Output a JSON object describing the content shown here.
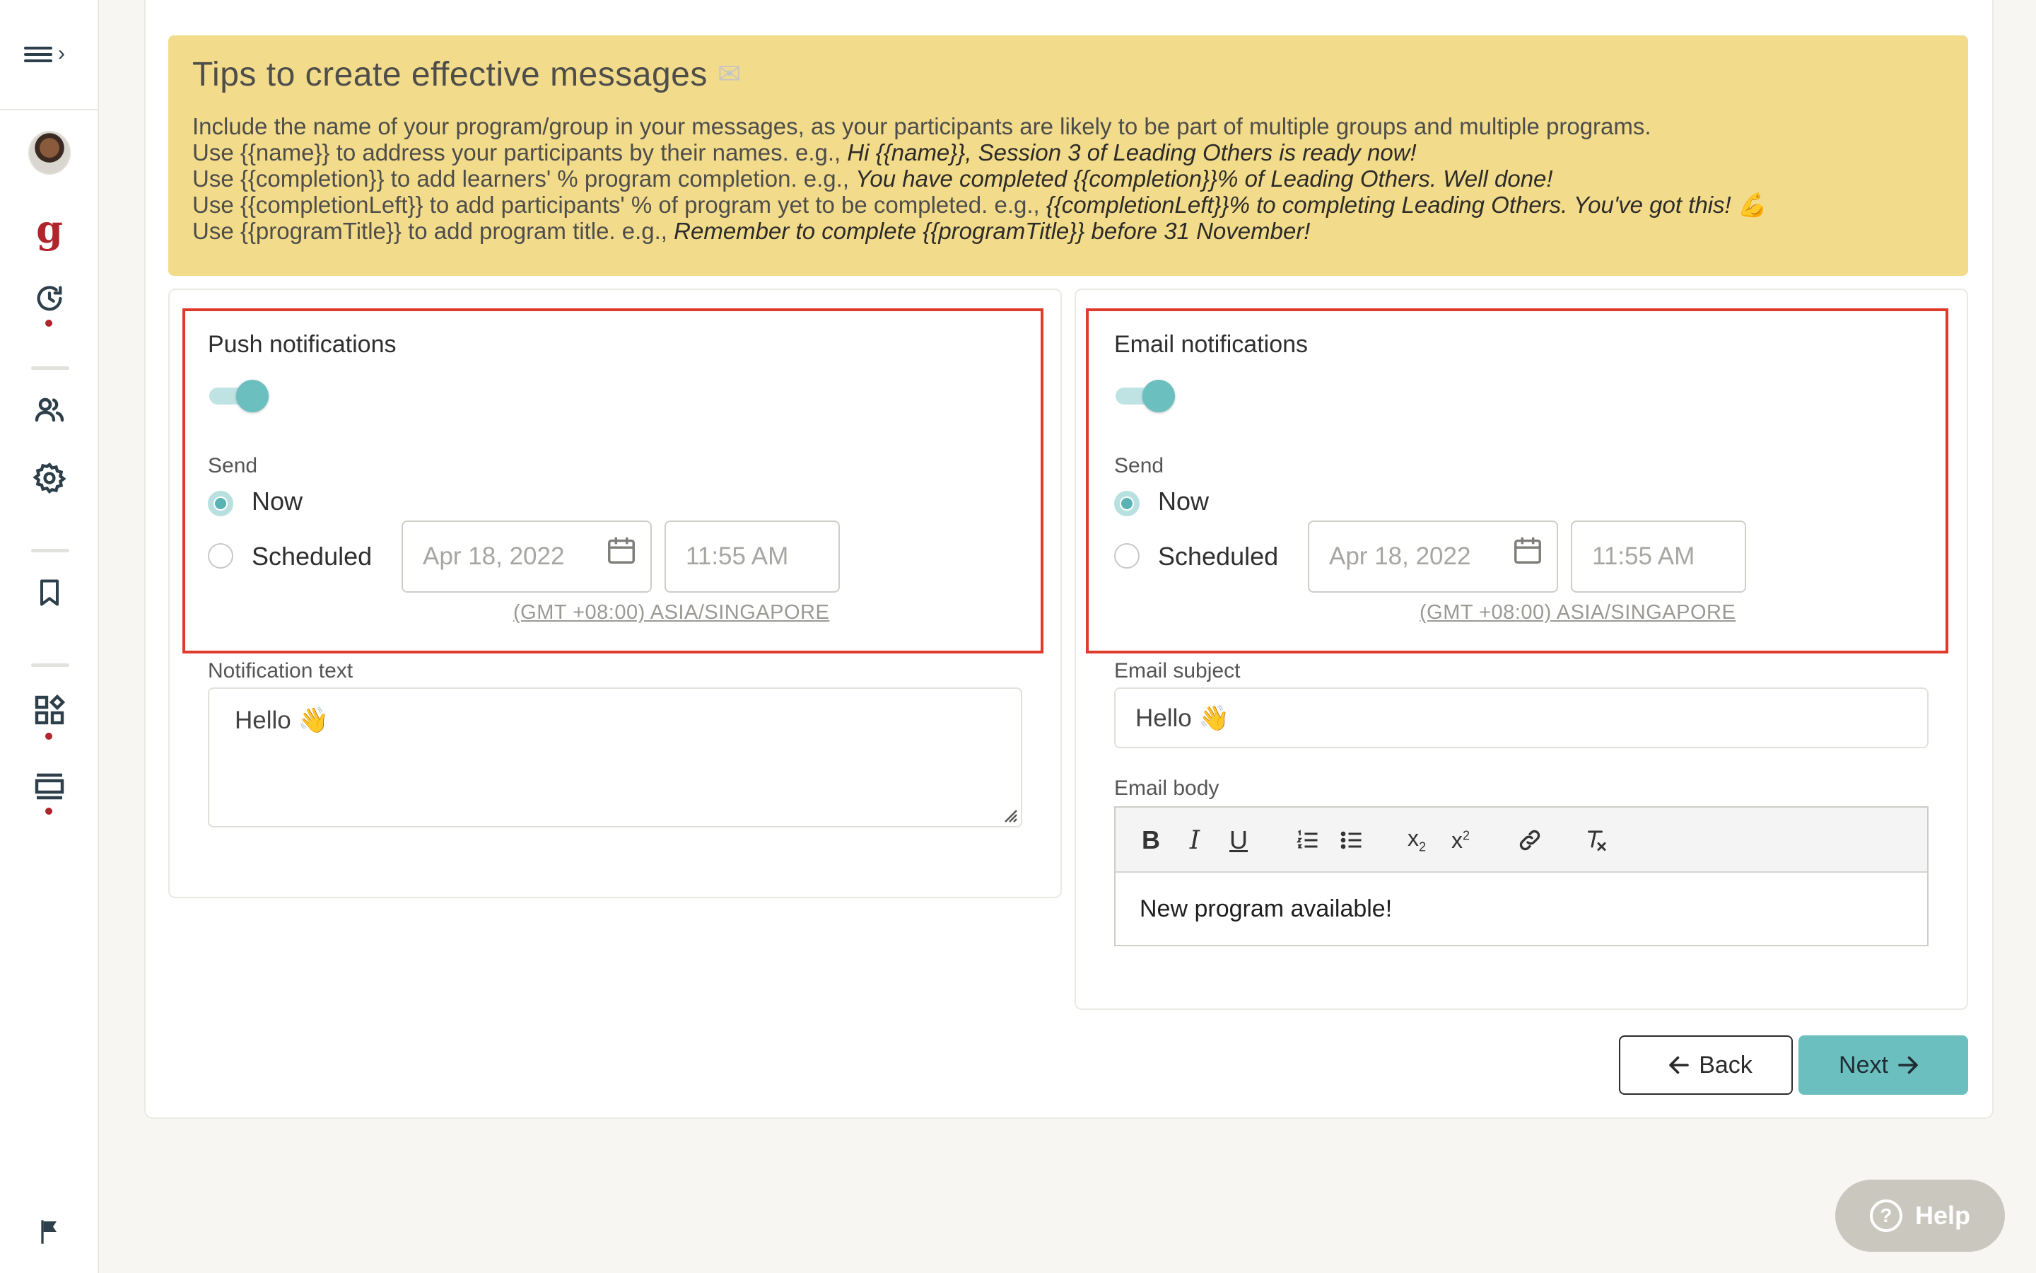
{
  "sidebar": {
    "logo_letter": "g"
  },
  "tips": {
    "title": "Tips to create effective messages",
    "line1": "Include the name of your program/group in your messages, as your participants are likely to be part of multiple groups and multiple programs.",
    "line2_text": "Use {{name}} to address your participants by their names. e.g., ",
    "line2_example": "Hi {{name}}, Session 3 of Leading Others is ready now!",
    "line3_text": "Use {{completion}} to add learners' % program completion. e.g., ",
    "line3_example": "You have completed {{completion}}% of Leading Others. Well done!",
    "line4_text": "Use {{completionLeft}} to add participants' % of program yet to be completed. e.g., ",
    "line4_example": "{{completionLeft}}% to completing Leading Others. You've got this! 💪",
    "line5_text": "Use {{programTitle}} to add program title. e.g., ",
    "line5_example": "Remember to complete {{programTitle}} before 31 November!"
  },
  "push": {
    "title": "Push notifications",
    "enabled": true,
    "send_label": "Send",
    "option_now": "Now",
    "option_scheduled": "Scheduled",
    "date_placeholder": "Apr 18, 2022",
    "time_placeholder": "11:55 AM",
    "timezone": "(GMT +08:00)  ASIA/SINGAPORE",
    "text_label": "Notification text",
    "text_value": "Hello 👋"
  },
  "email": {
    "title": "Email notifications",
    "enabled": true,
    "send_label": "Send",
    "option_now": "Now",
    "option_scheduled": "Scheduled",
    "date_placeholder": "Apr 18, 2022",
    "time_placeholder": "11:55 AM",
    "timezone": "(GMT +08:00)  ASIA/SINGAPORE",
    "subject_label": "Email subject",
    "subject_value": "Hello 👋",
    "body_label": "Email body",
    "body_value": "New program available!",
    "toolbar": {
      "bold": "B",
      "italic": "I",
      "underline": "U"
    }
  },
  "actions": {
    "back": "Back",
    "next": "Next"
  },
  "help": {
    "label": "Help"
  },
  "colors": {
    "accent": "#6bbfbf",
    "tips_bg": "#f2dc8c",
    "highlight_border": "#e03a2b",
    "brand_red": "#b0242b"
  }
}
